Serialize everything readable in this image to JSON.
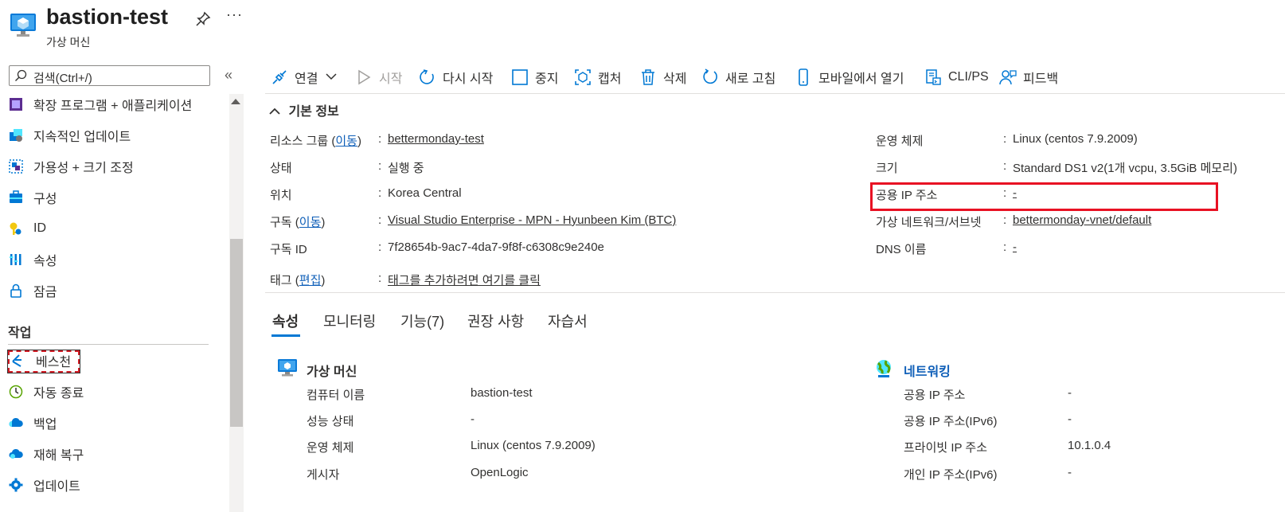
{
  "header": {
    "title": "bastion-test",
    "subtitle": "가상 머신",
    "more": "···"
  },
  "sidebar": {
    "search_placeholder": "검색(Ctrl+/)",
    "collapse": "«",
    "items": [
      {
        "label": "확장 프로그램 + 애플리케이션",
        "icon": "extensions-icon"
      },
      {
        "label": "지속적인 업데이트",
        "icon": "continuous-update-icon"
      },
      {
        "label": "가용성 + 크기 조정",
        "icon": "availability-scaling-icon"
      },
      {
        "label": "구성",
        "icon": "configuration-icon"
      },
      {
        "label": "ID",
        "icon": "identity-key-icon"
      },
      {
        "label": "속성",
        "icon": "properties-icon"
      },
      {
        "label": "잠금",
        "icon": "lock-icon"
      }
    ],
    "section_title": "작업",
    "ops_items": [
      {
        "label": "베스천",
        "icon": "bastion-icon"
      },
      {
        "label": "자동 종료",
        "icon": "auto-shutdown-clock-icon"
      },
      {
        "label": "백업",
        "icon": "backup-cloud-icon"
      },
      {
        "label": "재해 복구",
        "icon": "disaster-recovery-cloud-icon"
      },
      {
        "label": "업데이트",
        "icon": "updates-gear-icon"
      }
    ]
  },
  "toolbar": {
    "connect": "연결",
    "start": "시작",
    "restart": "다시 시작",
    "stop": "중지",
    "capture": "캡처",
    "delete": "삭제",
    "refresh": "새로 고침",
    "mobile": "모바일에서 열기",
    "cli": "CLI/PS",
    "feedback": "피드백"
  },
  "essentials": {
    "heading": "기본 정보",
    "resource_group_label": "리소스 그룹",
    "move_link": "이동",
    "resource_group_value": "bettermonday-test",
    "status_label": "상태",
    "status_value": "실행 중",
    "location_label": "위치",
    "location_value": "Korea Central",
    "subscription_label": "구독",
    "subscription_value": "Visual Studio Enterprise - MPN - Hyunbeen Kim (BTC)",
    "subscription_id_label": "구독 ID",
    "subscription_id_value": "7f28654b-9ac7-4da7-9f8f-c6308c9e240e",
    "tags_label": "태그",
    "tags_edit_link": "편집",
    "tags_value": "태그를 추가하려면 여기를 클릭",
    "os_label": "운영 체제",
    "os_value": "Linux (centos 7.9.2009)",
    "size_label": "크기",
    "size_value": "Standard DS1 v2(1개 vcpu, 3.5GiB 메모리)",
    "public_ip_label": "공용 IP 주소",
    "public_ip_value": "-",
    "vnet_label": "가상 네트워크/서브넷",
    "vnet_value": "bettermonday-vnet/default",
    "dns_label": "DNS 이름",
    "dns_value": "-",
    "colon": ":"
  },
  "tabs": [
    "속성",
    "모니터링",
    "기능(7)",
    "권장 사항",
    "자습서"
  ],
  "properties": {
    "vm": {
      "heading": "가상 머신",
      "rows": [
        {
          "label": "컴퓨터 이름",
          "value": "bastion-test"
        },
        {
          "label": "성능 상태",
          "value": "-"
        },
        {
          "label": "운영 체제",
          "value": "Linux (centos 7.9.2009)"
        },
        {
          "label": "게시자",
          "value": "OpenLogic"
        }
      ]
    },
    "network": {
      "heading": "네트워킹",
      "rows": [
        {
          "label": "공용 IP 주소",
          "value": "-"
        },
        {
          "label": "공용 IP 주소(IPv6)",
          "value": "-"
        },
        {
          "label": "프라이빗 IP 주소",
          "value": "10.1.0.4"
        },
        {
          "label": "개인 IP 주소(IPv6)",
          "value": "-"
        }
      ]
    }
  },
  "colors": {
    "accent": "#0078d4",
    "link": "#0f5fb8",
    "highlight_red": "#e81123"
  }
}
